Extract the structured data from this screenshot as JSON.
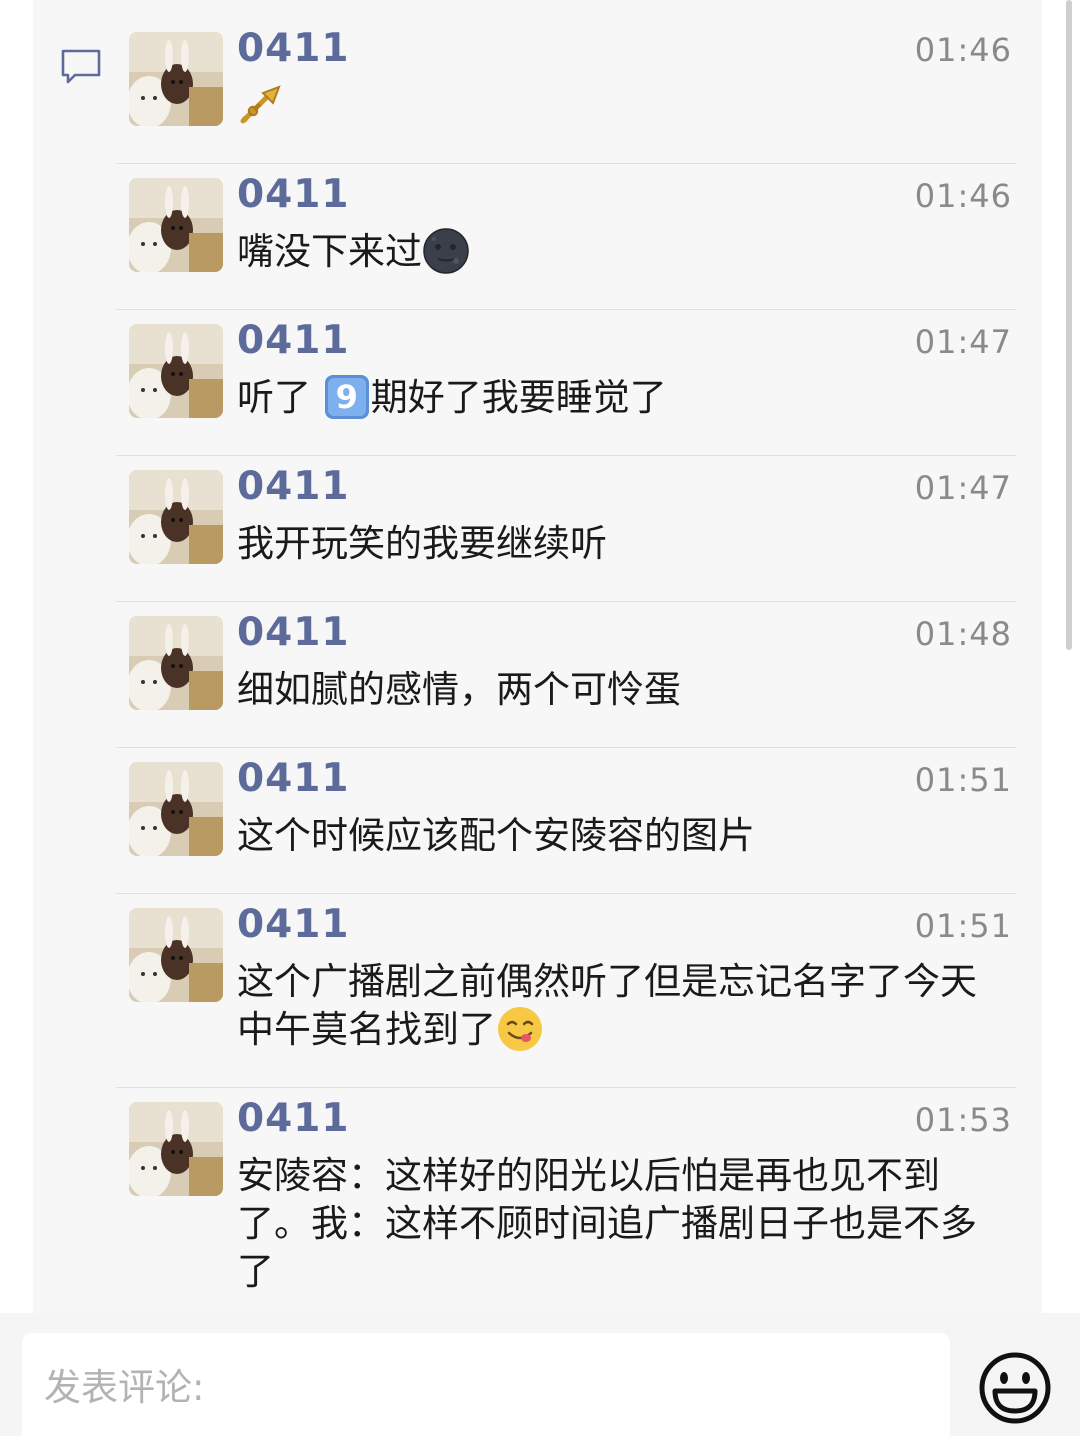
{
  "comments": [
    {
      "name": "0411",
      "time": "01:46",
      "text": "",
      "emoji": "trumpet-icon"
    },
    {
      "name": "0411",
      "time": "01:46",
      "text": "嘴没下来过",
      "emoji": "new-moon-face-icon"
    },
    {
      "name": "0411",
      "time": "01:47",
      "text_before": "听了",
      "keycap": "9",
      "text_after": "期好了我要睡觉了"
    },
    {
      "name": "0411",
      "time": "01:47",
      "text": "我开玩笑的我要继续听"
    },
    {
      "name": "0411",
      "time": "01:48",
      "text": "细如腻的感情，两个可怜蛋"
    },
    {
      "name": "0411",
      "time": "01:51",
      "text": "这个时候应该配个安陵容的图片"
    },
    {
      "name": "0411",
      "time": "01:51",
      "text": "这个广播剧之前偶然听了但是忘记名字了今天中午莫名找到了",
      "emoji": "yum-face-icon"
    },
    {
      "name": "0411",
      "time": "01:53",
      "text": "安陵容：这样好的阳光以后怕是再也见不到了。我：这样不顾时间追广播剧日子也是不多了"
    }
  ],
  "input": {
    "placeholder": "发表评论:"
  },
  "icons": {
    "comment": "comment-bubble-icon",
    "emoji_button": "smiley-icon"
  },
  "colors": {
    "name": "#5d6b9b",
    "time": "#8a8a8a",
    "panel": "#f7f7f7"
  }
}
